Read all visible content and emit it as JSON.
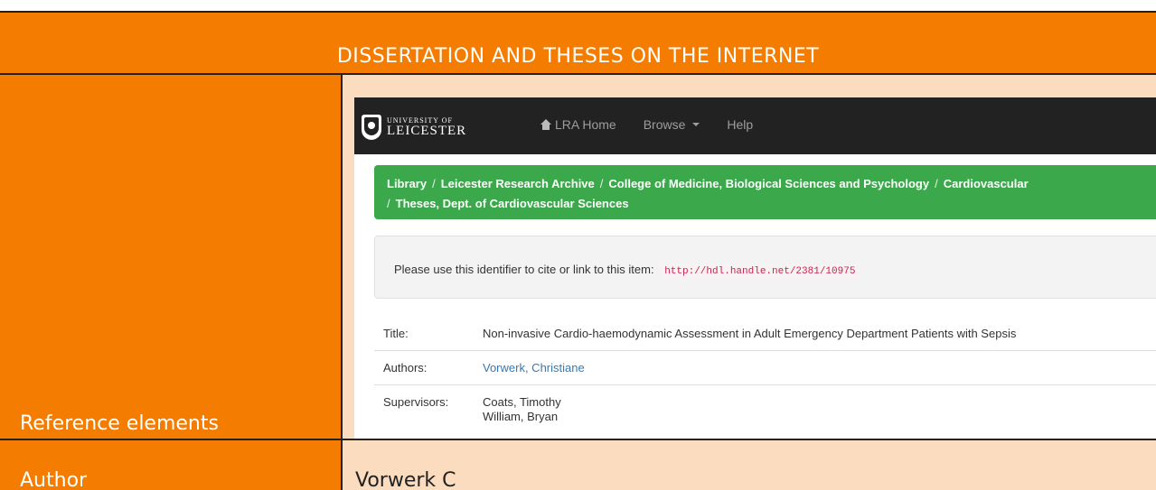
{
  "header": {
    "title": "DISSERTATION AND THESES ON THE INTERNET"
  },
  "left": {
    "reference_label": "Reference elements",
    "author_label": "Author"
  },
  "right": {
    "author_value": "Vorwerk C"
  },
  "screenshot": {
    "logo": {
      "line1": "UNIVERSITY OF",
      "line2": "LEICESTER"
    },
    "nav": [
      {
        "label": "LRA Home",
        "icon": "home-icon"
      },
      {
        "label": "Browse",
        "icon": "caret-down-icon"
      },
      {
        "label": "Help"
      }
    ],
    "breadcrumb": [
      "Library",
      "Leicester Research Archive",
      "College of Medicine, Biological Sciences and Psychology",
      "Cardiovascular",
      "Theses, Dept. of Cardiovascular Sciences"
    ],
    "cite": {
      "text": "Please use this identifier to cite or link to this item:",
      "url": "http://hdl.handle.net/2381/10975"
    },
    "metadata": {
      "title_label": "Title:",
      "title_value": "Non-invasive Cardio-haemodynamic Assessment in Adult Emergency Department Patients with Sepsis",
      "authors_label": "Authors:",
      "authors_value": "Vorwerk, Christiane",
      "supervisors_label": "Supervisors:",
      "supervisors_value_1": "Coats, Timothy",
      "supervisors_value_2": "William, Bryan"
    }
  },
  "colors": {
    "orange": "#f47c00",
    "peach": "#fbdcbf",
    "green": "#3aa84b",
    "navbar": "#222222"
  }
}
